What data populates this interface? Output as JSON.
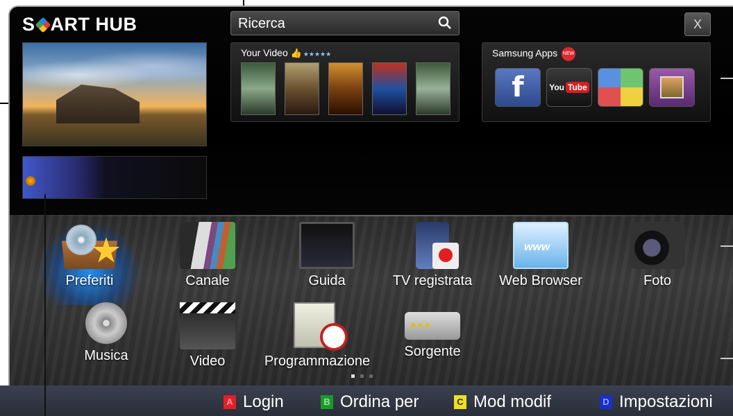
{
  "logo": {
    "part1": "S",
    "part2": "ART HUB"
  },
  "search": {
    "label": "Ricerca"
  },
  "close": {
    "label": "X"
  },
  "your_video": {
    "title": "Your Video",
    "stars": "★★★★★"
  },
  "samsung_apps": {
    "title": "Samsung Apps",
    "badge": "NEW",
    "youtube_you": "You",
    "youtube_tube": "Tube"
  },
  "apps_grid": [
    {
      "label": "Preferiti",
      "icon": "favorites-icon"
    },
    {
      "label": "Canale",
      "icon": "channel-icon"
    },
    {
      "label": "Guida",
      "icon": "guide-icon"
    },
    {
      "label": "TV registrata",
      "icon": "recorded-tv-icon"
    },
    {
      "label": "Web Browser",
      "icon": "web-browser-icon"
    },
    {
      "label": "Foto",
      "icon": "camera-icon"
    },
    {
      "label": "Musica",
      "icon": "music-icon"
    },
    {
      "label": "Video",
      "icon": "clapperboard-icon"
    },
    {
      "label": "Programmazione",
      "icon": "schedule-icon"
    },
    {
      "label": "Sorgente",
      "icon": "source-icon"
    }
  ],
  "bottom_bar": [
    {
      "key": "A",
      "label": "Login",
      "color": "#e0202a"
    },
    {
      "key": "B",
      "label": "Ordina per",
      "color": "#1a9a2a"
    },
    {
      "key": "C",
      "label": "Mod modif",
      "color": "#f0e020"
    },
    {
      "key": "D",
      "label": "Impostazioni",
      "color": "#1830c8"
    }
  ],
  "web_icon_text": "www",
  "colors": {
    "highlight": "#1e8fff",
    "frame": "#000000"
  }
}
